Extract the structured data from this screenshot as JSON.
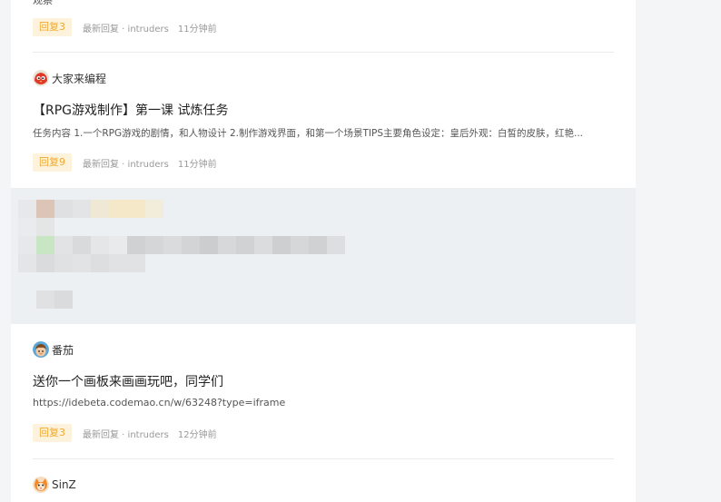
{
  "posts": [
    {
      "summary_partial": "观察",
      "reply_label": "回复3",
      "last_reply": "最新回复 · intruders",
      "time": "11分钟前"
    },
    {
      "author": "大家来编程",
      "avatar_icon": "red-bird-avatar-icon",
      "title": "【RPG游戏制作】第一课 试炼任务",
      "summary": "任务内容 1.一个RPG游戏的剧情，和人物设计 2.制作游戏界面，和第一个场景TIPS主要角色设定：皇后外观：白皙的皮肤，红艳...",
      "reply_label": "回复9",
      "last_reply": "最新回复 · intruders",
      "time": "11分钟前"
    },
    {
      "author": "番茄",
      "avatar_icon": "boy-avatar-icon",
      "title": "送你一个画板来画画玩吧，同学们",
      "link": "https://idebeta.codemao.cn/w/63248?type=iframe",
      "reply_label": "回复3",
      "last_reply": "最新回复 · intruders",
      "time": "12分钟前"
    },
    {
      "author": "SinZ",
      "avatar_icon": "cat-avatar-icon"
    }
  ],
  "colors": {
    "accent_badge_bg": "#fdf3dc",
    "accent_badge_text": "#f0a830",
    "highlight_bg": "#edf0f2"
  }
}
